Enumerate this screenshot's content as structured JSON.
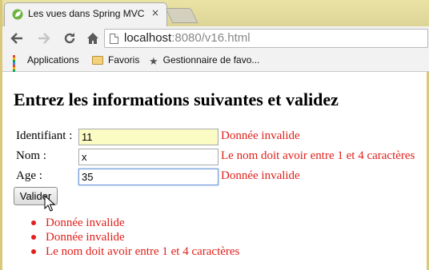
{
  "browser": {
    "tab": {
      "title": "Les vues dans Spring MVC",
      "close_glyph": "×"
    },
    "address": {
      "host": "localhost",
      "rest": ":8080/v16.html"
    },
    "bookmarks": [
      {
        "label": "Applications",
        "icon": "apps-grid-icon"
      },
      {
        "label": "Favoris",
        "icon": "folder-icon"
      },
      {
        "label": "Gestionnaire de favo...",
        "icon": "star-icon"
      }
    ],
    "accent": "#e9e3a4"
  },
  "page": {
    "heading": "Entrez les informations suivantes et validez",
    "fields": {
      "identifiant": {
        "label": "Identifiant :",
        "value": "11",
        "error": "Donnée invalide"
      },
      "nom": {
        "label": "Nom :",
        "value": "x",
        "error": "Le nom doit avoir entre 1 et 4 caractères"
      },
      "age": {
        "label": "Age :",
        "value": "35",
        "error": "Donnée invalide"
      }
    },
    "submit_label": "Valider",
    "error_list": [
      "Donnée invalide",
      "Donnée invalide",
      "Le nom doit avoir entre 1 et 4 caractères"
    ],
    "error_color": "#e0201b"
  }
}
